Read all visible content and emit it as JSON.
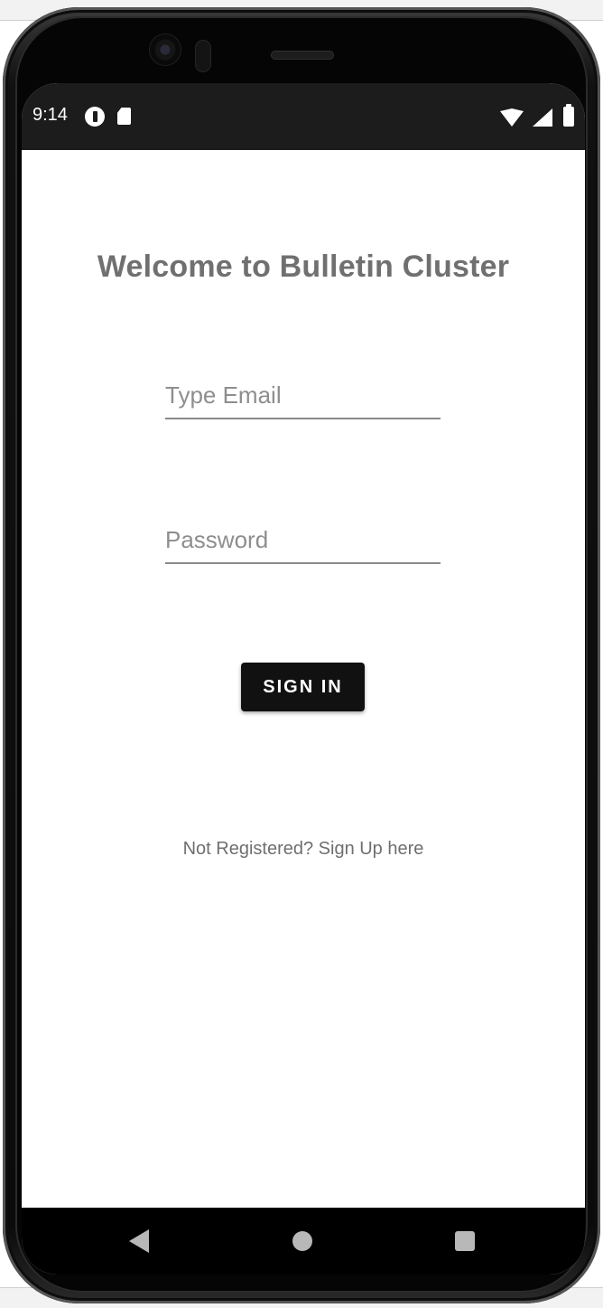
{
  "status_bar": {
    "time": "9:14",
    "left_icons": [
      "notification-app-icon",
      "sd-card-icon"
    ],
    "right_icons": [
      "wifi-icon",
      "cellular-signal-icon",
      "battery-icon"
    ]
  },
  "login": {
    "title": "Welcome to Bulletin Cluster",
    "email": {
      "placeholder": "Type Email",
      "value": ""
    },
    "password": {
      "placeholder": "Password",
      "value": ""
    },
    "signin_label": "SIGN IN",
    "signup_text": "Not Registered? Sign Up here"
  },
  "nav_bar": {
    "buttons": [
      "back-icon",
      "home-icon",
      "recents-icon"
    ]
  },
  "colors": {
    "title": "#707070",
    "button_bg": "#111111",
    "button_text": "#ffffff",
    "link_text": "#6f6f6f",
    "underline": "#8a8a8a",
    "status_bar_bg": "#1c1c1c",
    "nav_bar_bg": "#000000"
  }
}
